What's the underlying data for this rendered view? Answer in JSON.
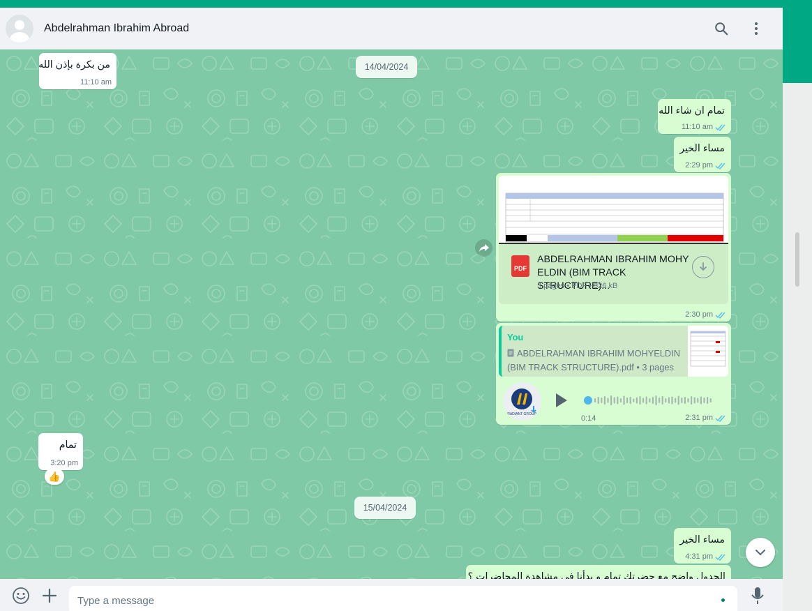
{
  "header": {
    "contact_name": "Abdelrahman Ibrahim Abroad",
    "search_icon": "search-icon",
    "menu_icon": "kebab-menu-icon"
  },
  "date_chips": [
    "14/04/2024",
    "15/04/2024"
  ],
  "messages": [
    {
      "direction": "in",
      "text": "من بكرة بإذن الله",
      "time": "11:10 am"
    },
    {
      "direction": "out",
      "text": "تمام ان شاء الله",
      "time": "11:10 am",
      "status": "read"
    },
    {
      "direction": "out",
      "text": "مساء الخير",
      "time": "2:29 pm",
      "status": "read"
    },
    {
      "direction": "out",
      "type": "document",
      "file_name": "ABDELRAHMAN IBRAHIM MOHY ELDIN (BIM TRACK STRUCTURE)...",
      "file_meta": "3 pages • PDF • 326 kB",
      "file_icon_label": "PDF",
      "time": "2:30 pm",
      "status": "read"
    },
    {
      "direction": "out",
      "type": "voice",
      "quote_author": "You",
      "quote_text": "ABDELRAHMAN IBRAHIM MOHYELDIN (BIM TRACK STRUCTURE).pdf • 3 pages",
      "duration": "0:14",
      "avatar_brand": "RADIANT GROUP",
      "time": "2:31 pm",
      "status": "read"
    },
    {
      "direction": "in",
      "text": "تمام",
      "time": "3:20 pm",
      "reaction": "👍"
    },
    {
      "direction": "out",
      "text": "مساء الخير",
      "time": "4:31 pm",
      "status": "read"
    },
    {
      "direction": "out",
      "text": "الجدول واضح مع حضرتك تمام و بدأنا في مشاهدة المحاضرات ؟",
      "partial": true
    }
  ],
  "composer": {
    "placeholder": "Type a message"
  },
  "colors": {
    "accent": "#00a884",
    "chat_background": "#80c9a6",
    "outgoing_bubble": "#d9fdd3",
    "incoming_bubble": "#ffffff",
    "read_ticks": "#53bdeb"
  }
}
